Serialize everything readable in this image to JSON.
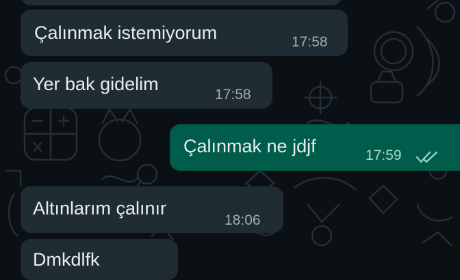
{
  "chat": {
    "messages": [
      {
        "direction": "incoming",
        "text": "",
        "time": ""
      },
      {
        "direction": "incoming",
        "text": "Çalınmak istemiyorum",
        "time": "17:58"
      },
      {
        "direction": "incoming",
        "text": "Yer bak gidelim",
        "time": "17:58"
      },
      {
        "direction": "outgoing",
        "text": "Çalınmak ne jdjf",
        "time": "17:59",
        "status": "read"
      },
      {
        "direction": "incoming",
        "text": "Altınlarım çalınır",
        "time": "18:06"
      },
      {
        "direction": "incoming",
        "text": "Dmkdlfk",
        "time": ""
      }
    ]
  },
  "icons": {
    "read_receipt": "double-check-icon",
    "wallpaper": "doodle-pattern"
  },
  "colors": {
    "background": "#0b1014",
    "incoming_bubble": "#202c33",
    "outgoing_bubble": "#005c4b",
    "message_text": "#e9edef",
    "incoming_time": "#a3abb0",
    "outgoing_time": "#b5d6cd",
    "read_tick": "#9ad0c4",
    "wallpaper_doodle": "#27313a"
  }
}
